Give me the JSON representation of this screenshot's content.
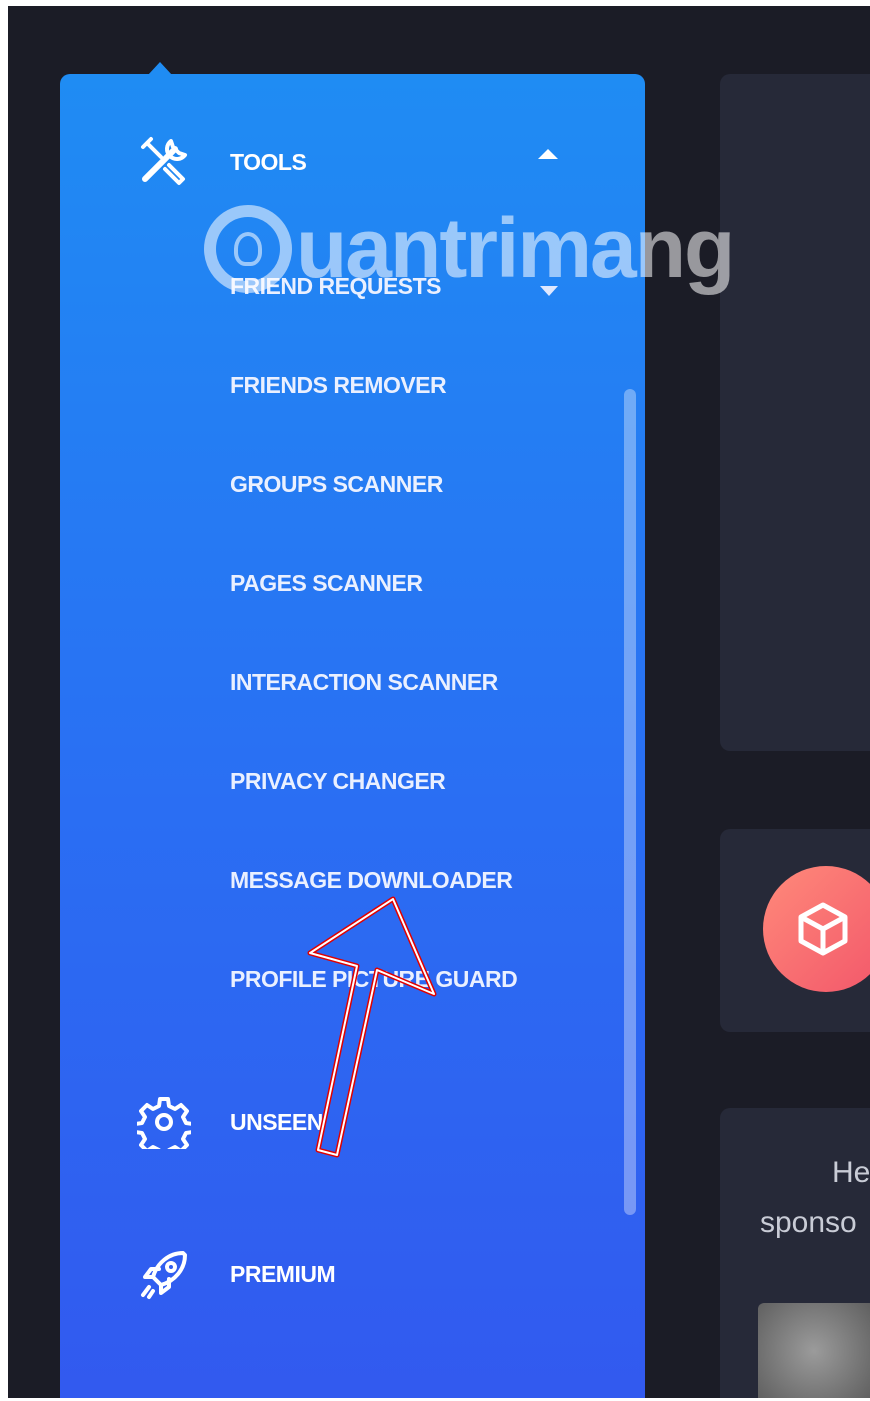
{
  "menu": {
    "tools_label": "TOOLS",
    "submenu": [
      {
        "label": "FRIEND REQUESTS"
      },
      {
        "label": "FRIENDS REMOVER"
      },
      {
        "label": "GROUPS SCANNER"
      },
      {
        "label": "PAGES SCANNER"
      },
      {
        "label": "INTERACTION SCANNER"
      },
      {
        "label": "PRIVACY CHANGER"
      },
      {
        "label": "MESSAGE DOWNLOADER"
      },
      {
        "label": "PROFILE PICTURE GUARD"
      }
    ],
    "unseen_label": "UNSEEN",
    "premium_label": "PREMIUM"
  },
  "right_panel": {
    "text_line1": "He",
    "text_line2": "sponso"
  },
  "watermark": {
    "text": "uantrimang"
  },
  "icons": {
    "tools": "tools-icon",
    "expand": "chevron-up-icon",
    "friend_requests_expand": "chevron-down-icon",
    "unseen": "gear-icon",
    "premium": "rocket-icon",
    "cube": "cube-icon",
    "annotation": "red-arrow-icon"
  },
  "colors": {
    "panel_top": "#1f8cf3",
    "panel_bottom": "#3259ef",
    "background": "#1b1c26",
    "card": "#262938",
    "arrow": "#e00000"
  }
}
